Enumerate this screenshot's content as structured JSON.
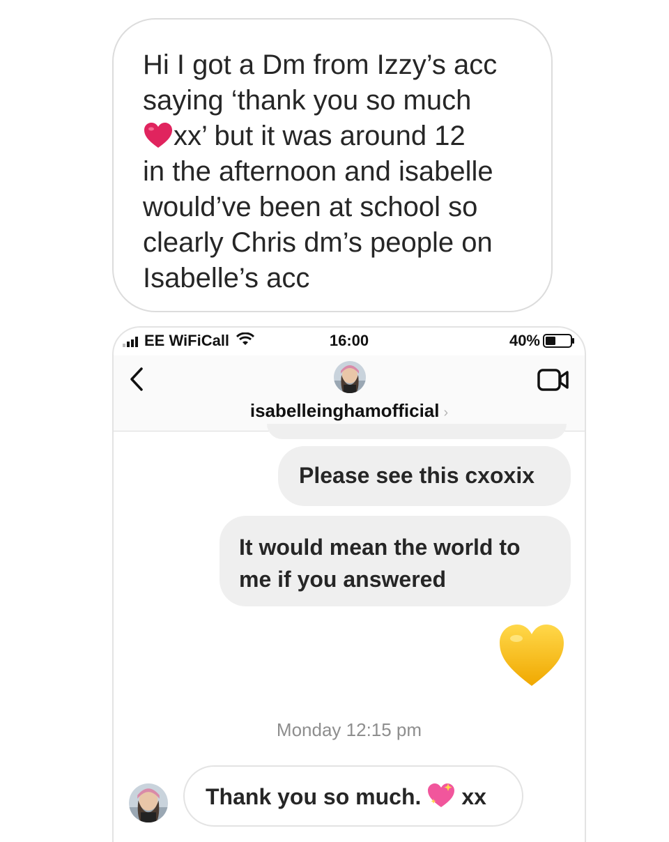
{
  "caption": {
    "lines": [
      "Hi I got a Dm from Izzy’s acc",
      "saying ‘thank you so much",
      "xx’ but it was around 12",
      "in the afternoon and isabelle",
      "would’ve been at school so",
      "clearly Chris dm’s people on",
      "Isabelle’s acc"
    ],
    "inline_icon": "red-heart-icon"
  },
  "status_bar": {
    "carrier": "EE WiFiCall",
    "time": "16:00",
    "battery": "40%",
    "battery_level": 0.4
  },
  "header": {
    "username": "isabelleinghamofficial",
    "chevron": "›",
    "icons": [
      "back-chevron-icon",
      "profile-avatar",
      "video-call-icon"
    ]
  },
  "messages": {
    "outgoing": [
      {
        "lines": [
          "Please see this cxoxix"
        ]
      },
      {
        "lines": [
          "It would mean the world to",
          "me if you answered"
        ]
      }
    ],
    "outgoing_emoji": "yellow-heart-icon",
    "timestamp": "Monday 12:15 pm",
    "incoming": {
      "before_emoji": "Thank you so much.",
      "emoji": "sparkling-heart-icon",
      "after_emoji": "xx"
    }
  },
  "colors": {
    "bubble_gray": "#efefef",
    "text": "#262626",
    "muted": "#8e8e8e",
    "heart_red": "#e0245e",
    "heart_yellow": "#f5b800"
  }
}
